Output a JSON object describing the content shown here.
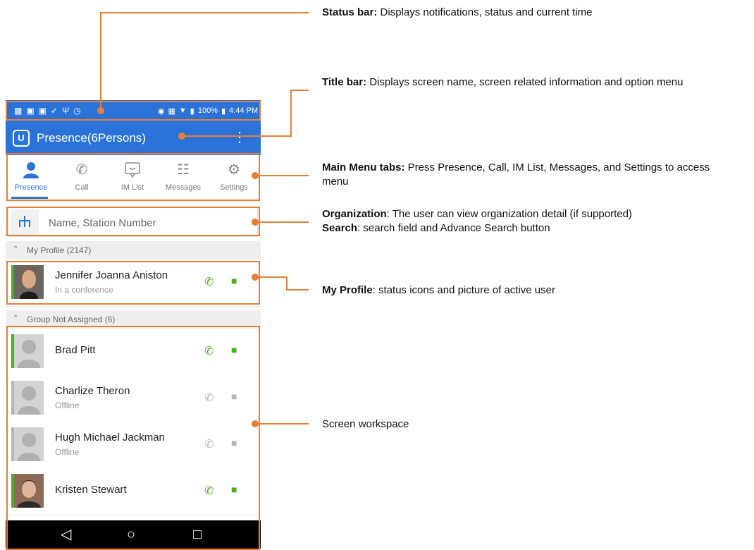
{
  "status_bar": {
    "left_icons": [
      "battery-saver-icon",
      "app-icon",
      "app-icon",
      "download-icon",
      "usb-icon",
      "alarm-icon"
    ],
    "battery_text": "100%",
    "time": "4:44 PM"
  },
  "title_bar": {
    "logo": "U",
    "title": "Presence(6Persons)",
    "menu_glyph": "⋮"
  },
  "tabs": [
    {
      "label": "Presence",
      "icon": "person-icon",
      "active": true
    },
    {
      "label": "Call",
      "icon": "phone-icon",
      "active": false
    },
    {
      "label": "IM List",
      "icon": "chat-icon",
      "active": false
    },
    {
      "label": "Messages",
      "icon": "list-icon",
      "active": false
    },
    {
      "label": "Settings",
      "icon": "gear-icon",
      "active": false
    }
  ],
  "search": {
    "placeholder": "Name, Station Number"
  },
  "my_profile": {
    "header": "My Profile (2147)",
    "name": "Jennifer Joanna Aniston",
    "status": "In a conference"
  },
  "group": {
    "header": "Group Not Assigned  (6)",
    "contacts": [
      {
        "name": "Brad Pitt",
        "status": "",
        "online": true
      },
      {
        "name": "Charlize Theron",
        "status": "Offline",
        "online": false
      },
      {
        "name": "Hugh Michael Jackman",
        "status": "Offline",
        "online": false
      },
      {
        "name": "Kristen Stewart",
        "status": "",
        "online": true
      }
    ]
  },
  "colors": {
    "brand": "#2b73d9",
    "online": "#4caf1f",
    "offline": "#b5b5b5",
    "callout": "#ed7d31"
  },
  "annotations": {
    "status_bar": {
      "term": "Status bar:",
      "text": " Displays notifications, status and current time"
    },
    "title_bar": {
      "term": "Title bar:",
      "text": " Displays screen name, screen related information and option menu"
    },
    "main_menu": {
      "term": "Main Menu tabs:",
      "text": " Press Presence, Call, IM List, Messages, and Settings to access menu"
    },
    "organization": {
      "term": "Organization",
      "text": ": The user can view organization detail (if supported)"
    },
    "search": {
      "term": "Search",
      "text": ": search field and Advance Search button"
    },
    "my_profile": {
      "term": "My Profile",
      "text": ": status icons and picture of active user"
    },
    "workspace": {
      "term": "",
      "text": "Screen workspace"
    }
  }
}
